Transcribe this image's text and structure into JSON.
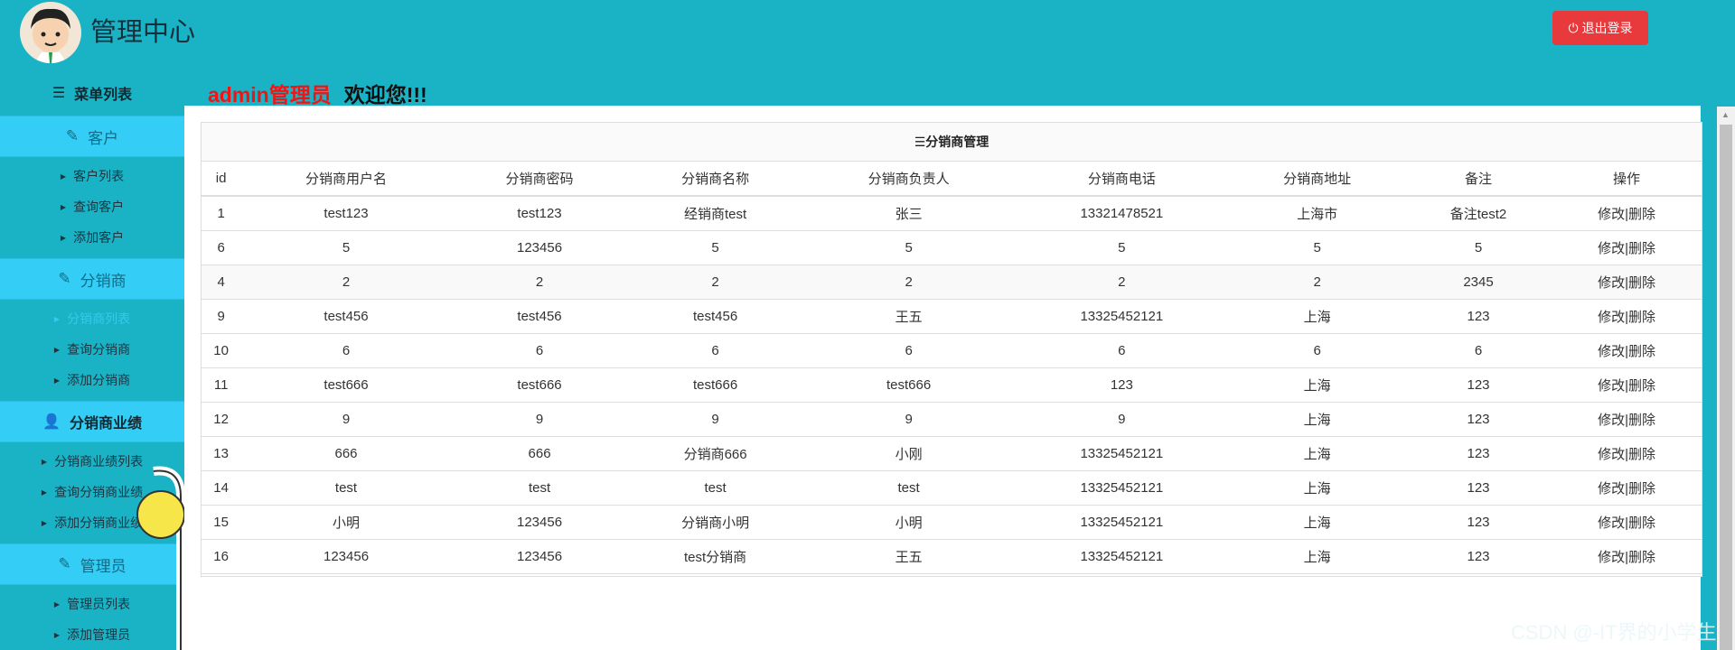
{
  "header": {
    "app_title": "管理中心",
    "logout_label": "退出登录"
  },
  "welcome": {
    "role": "admin管理员",
    "greeting": "欢迎您!!!"
  },
  "sidebar": {
    "menu_title": "菜单列表",
    "sections": [
      {
        "label": "客户",
        "icon": "edit-icon",
        "items": [
          "客户列表",
          "查询客户",
          "添加客户"
        ]
      },
      {
        "label": "分销商",
        "icon": "edit-icon",
        "items": [
          "分销商列表",
          "查询分销商",
          "添加分销商"
        ],
        "active_item": "分销商列表"
      },
      {
        "label": "分销商业绩",
        "icon": "user-icon",
        "items": [
          "分销商业绩列表",
          "查询分销商业绩",
          "添加分销商业绩"
        ]
      },
      {
        "label": "管理员",
        "icon": "edit-icon",
        "items": [
          "管理员列表",
          "添加管理员"
        ]
      }
    ]
  },
  "table": {
    "caption": "☰分销商管理",
    "columns": [
      "id",
      "分销商用户名",
      "分销商密码",
      "分销商名称",
      "分销商负责人",
      "分销商电话",
      "分销商地址",
      "备注",
      "操作"
    ],
    "op_edit": "修改",
    "op_sep": "|",
    "op_delete": "删除",
    "rows": [
      [
        "1",
        "test123",
        "test123",
        "经销商test",
        "张三",
        "13321478521",
        "上海市",
        "备注test2"
      ],
      [
        "6",
        "5",
        "123456",
        "5",
        "5",
        "5",
        "5",
        "5"
      ],
      [
        "4",
        "2",
        "2",
        "2",
        "2",
        "2",
        "2",
        "2345"
      ],
      [
        "9",
        "test456",
        "test456",
        "test456",
        "王五",
        "13325452121",
        "上海",
        "123"
      ],
      [
        "10",
        "6",
        "6",
        "6",
        "6",
        "6",
        "6",
        "6"
      ],
      [
        "11",
        "test666",
        "test666",
        "test666",
        "test666",
        "123",
        "上海",
        "123"
      ],
      [
        "12",
        "9",
        "9",
        "9",
        "9",
        "9",
        "上海",
        "123"
      ],
      [
        "13",
        "666",
        "666",
        "分销商666",
        "小刚",
        "13325452121",
        "上海",
        "123"
      ],
      [
        "14",
        "test",
        "test",
        "test",
        "test",
        "13325452121",
        "上海",
        "123"
      ],
      [
        "15",
        "小明",
        "123456",
        "分销商小明",
        "小明",
        "13325452121",
        "上海",
        "123"
      ],
      [
        "16",
        "123456",
        "123456",
        "test分销商",
        "王五",
        "13325452121",
        "上海",
        "123"
      ]
    ]
  },
  "watermark": "CSDN @-IT界的小学生",
  "colors": {
    "background": "#1ab3c6",
    "section_header": "#34cdf6",
    "logout": "#e8393c",
    "role_text": "#f01515",
    "active_link": "#36c9ea"
  }
}
